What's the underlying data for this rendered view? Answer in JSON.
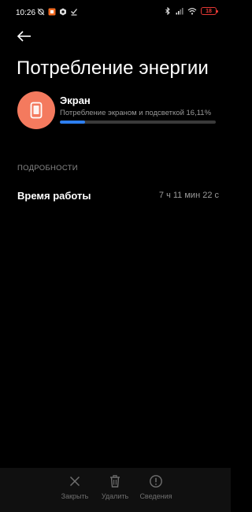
{
  "status_bar": {
    "time": "10:26",
    "battery_level": "18",
    "battery_color": "#e53935"
  },
  "header": {
    "back_icon": "arrow-left-icon",
    "title": "Потребление энергии"
  },
  "usage": {
    "icon": "phone-screen-icon",
    "icon_bg_color": "#f47a5e",
    "title": "Экран",
    "description": "Потребление экраном и подсветкой 16,11%",
    "percent": 16.11,
    "bar_color": "#2d7ff0"
  },
  "details": {
    "section_title": "ПОДРОБНОСТИ",
    "rows": [
      {
        "label": "Время работы",
        "value": "7 ч 11 мин 22 с"
      }
    ]
  },
  "bottom_bar": {
    "actions": [
      {
        "label": "Закрыть",
        "icon": "close-icon"
      },
      {
        "label": "Удалить",
        "icon": "trash-icon"
      },
      {
        "label": "Сведения",
        "icon": "info-icon"
      }
    ]
  }
}
